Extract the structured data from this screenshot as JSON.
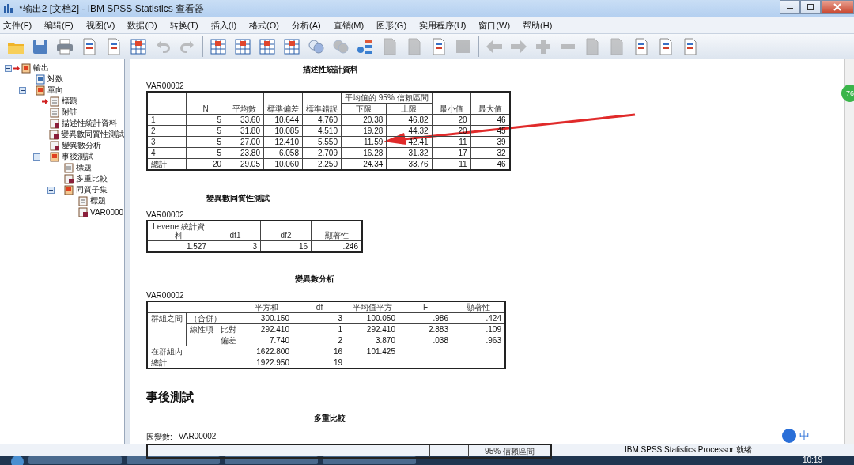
{
  "window": {
    "title": "*输出2 [文档2] - IBM SPSS Statistics 查看器"
  },
  "menu": [
    "文件(F)",
    "编辑(E)",
    "视图(V)",
    "数据(D)",
    "转换(T)",
    "插入(I)",
    "格式(O)",
    "分析(A)",
    "直销(M)",
    "图形(G)",
    "实用程序(U)",
    "窗口(W)",
    "帮助(H)"
  ],
  "toolbar": [
    {
      "kind": "folder",
      "disabled": false
    },
    {
      "kind": "floppy",
      "disabled": false
    },
    {
      "kind": "printer",
      "disabled": false
    },
    {
      "kind": "page",
      "disabled": false
    },
    {
      "kind": "page",
      "disabled": false
    },
    {
      "kind": "grid",
      "disabled": false
    },
    {
      "kind": "undo",
      "disabled": true
    },
    {
      "kind": "redo",
      "disabled": true
    },
    {
      "kind": "separator"
    },
    {
      "kind": "grid",
      "disabled": false
    },
    {
      "kind": "grid",
      "disabled": false
    },
    {
      "kind": "grid",
      "disabled": false
    },
    {
      "kind": "grid",
      "disabled": false
    },
    {
      "kind": "circles",
      "disabled": false
    },
    {
      "kind": "circles",
      "disabled": true
    },
    {
      "kind": "tree",
      "disabled": false
    },
    {
      "kind": "page",
      "disabled": true
    },
    {
      "kind": "page",
      "disabled": true
    },
    {
      "kind": "page",
      "disabled": false
    },
    {
      "kind": "square",
      "disabled": true
    },
    {
      "kind": "separator"
    },
    {
      "kind": "left",
      "disabled": true
    },
    {
      "kind": "right",
      "disabled": true
    },
    {
      "kind": "plus",
      "disabled": true
    },
    {
      "kind": "minus",
      "disabled": true
    },
    {
      "kind": "page",
      "disabled": true
    },
    {
      "kind": "page",
      "disabled": true
    },
    {
      "kind": "page",
      "disabled": false
    },
    {
      "kind": "page",
      "disabled": false
    },
    {
      "kind": "page",
      "disabled": false
    }
  ],
  "tree": [
    {
      "label": "輸出",
      "kind": "folder",
      "current": true,
      "expanded": true,
      "children": [
        {
          "label": "対数",
          "kind": "log",
          "current": false
        },
        {
          "label": "單向",
          "kind": "folder",
          "current": false,
          "expanded": true,
          "children": [
            {
              "label": "標題",
              "kind": "title",
              "current": true
            },
            {
              "label": "附註",
              "kind": "note",
              "current": false
            },
            {
              "label": "描述性統計資料",
              "kind": "table",
              "current": false
            },
            {
              "label": "變異數同質性測試",
              "kind": "table",
              "current": false
            },
            {
              "label": "變異數分析",
              "kind": "table",
              "current": false
            },
            {
              "label": "事後測試",
              "kind": "folder",
              "current": false,
              "expanded": true,
              "children": [
                {
                  "label": "標題",
                  "kind": "title",
                  "current": false
                },
                {
                  "label": "多重比較",
                  "kind": "table",
                  "current": false
                },
                {
                  "label": "同質子集",
                  "kind": "folder",
                  "current": false,
                  "expanded": true,
                  "children": [
                    {
                      "label": "標題",
                      "kind": "title",
                      "current": false
                    },
                    {
                      "label": "VAR0000",
                      "kind": "table",
                      "current": false
                    }
                  ]
                }
              ]
            }
          ]
        }
      ]
    }
  ],
  "descriptives": {
    "title": "描述性統計資料",
    "variable": "VAR00002",
    "columns": [
      "N",
      "平均數",
      "標準偏差",
      "標準錯誤",
      "下限",
      "上限",
      "最小值",
      "最大值"
    ],
    "ci_header": "平均值的 95% 信賴區間",
    "rows": [
      {
        "label": "1",
        "values": [
          "5",
          "33.60",
          "10.644",
          "4.760",
          "20.38",
          "46.82",
          "20",
          "46"
        ]
      },
      {
        "label": "2",
        "values": [
          "5",
          "31.80",
          "10.085",
          "4.510",
          "19.28",
          "44.32",
          "20",
          "45"
        ]
      },
      {
        "label": "3",
        "values": [
          "5",
          "27.00",
          "12.410",
          "5.550",
          "11.59",
          "42.41",
          "11",
          "39"
        ]
      },
      {
        "label": "4",
        "values": [
          "5",
          "23.80",
          "6.058",
          "2.709",
          "16.28",
          "31.32",
          "17",
          "32"
        ]
      },
      {
        "label": "總計",
        "values": [
          "20",
          "29.05",
          "10.060",
          "2.250",
          "24.34",
          "33.76",
          "11",
          "46"
        ]
      }
    ]
  },
  "homogeneity": {
    "title": "變異數同質性測試",
    "variable": "VAR00002",
    "columns": [
      "Levene 統計資料",
      "df1",
      "df2",
      "顯著性"
    ],
    "values": [
      "1.527",
      "3",
      "16",
      ".246"
    ]
  },
  "anova": {
    "title": "變異數分析",
    "variable": "VAR00002",
    "columns": [
      "平方和",
      "df",
      "平均值平方",
      "F",
      "顯著性"
    ],
    "rows": [
      {
        "labels": [
          "群組之間",
          "（合併）"
        ],
        "values": [
          "300.150",
          "3",
          "100.050",
          ".986",
          ".424"
        ]
      },
      {
        "labels": [
          "線性項",
          "比對"
        ],
        "values": [
          "292.410",
          "1",
          "292.410",
          "2.883",
          ".109"
        ]
      },
      {
        "labels": [
          "偏差"
        ],
        "values": [
          "7.740",
          "2",
          "3.870",
          ".038",
          ".963"
        ]
      },
      {
        "labels": [
          "在群組內"
        ],
        "values": [
          "1622.800",
          "16",
          "101.425"
        ]
      },
      {
        "labels": [
          "總計"
        ],
        "values": [
          "1922.950",
          "19"
        ]
      }
    ]
  },
  "posthoc": {
    "heading": "事後測試",
    "title": "多重比較",
    "dependent_label": "因變數:",
    "variable": "VAR00002",
    "ci_header": "95% 信賴區間"
  },
  "side_badge": "76",
  "ime": {
    "label": "中"
  },
  "status_bar": "IBM SPSS Statistics Processor 就绪",
  "clock": "10:19"
}
